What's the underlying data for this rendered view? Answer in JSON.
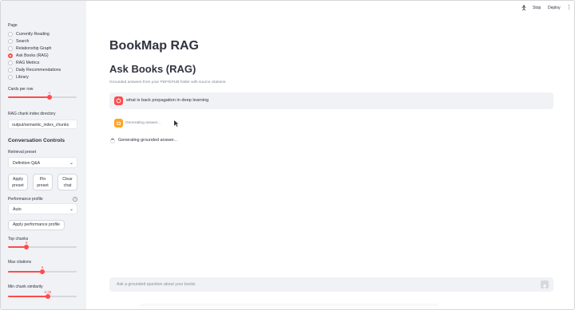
{
  "colors": {
    "accent": "#ff4b4b",
    "sidebar_bg": "#f0f2f6",
    "assistant_avatar": "#ffa421",
    "text": "#31333f",
    "muted": "#808495"
  },
  "topbar": {
    "stop_label": "Stop",
    "deploy_label": "Deploy",
    "running_icon": "running-man-icon",
    "menu_icon": "more-vertical-icon"
  },
  "sidebar": {
    "page_label": "Page",
    "pages": [
      {
        "label": "Currently Reading",
        "selected": false
      },
      {
        "label": "Search",
        "selected": false
      },
      {
        "label": "Relationship Graph",
        "selected": false
      },
      {
        "label": "Ask Books (RAG)",
        "selected": true
      },
      {
        "label": "RAG Metrics",
        "selected": false
      },
      {
        "label": "Daily Recommendations",
        "selected": false
      },
      {
        "label": "Library",
        "selected": false
      }
    ],
    "cards_per_row": {
      "label": "Cards per row",
      "value": "4",
      "fraction": 0.6
    },
    "rag_dir": {
      "label": "RAG chunk index directory",
      "value": "output/semantic_index_chunks"
    },
    "conversation_controls_title": "Conversation Controls",
    "retrieval_preset": {
      "label": "Retrieval preset",
      "value": "Definition Q&A"
    },
    "buttons": {
      "apply_preset": "Apply preset",
      "pin_preset": "Pin preset",
      "clear_chat": "Clear chat"
    },
    "performance_profile": {
      "label": "Performance profile",
      "value": "Auto"
    },
    "apply_performance_label": "Apply performance profile",
    "top_chunks": {
      "label": "Top chunks",
      "value": "8",
      "fraction": 0.27
    },
    "max_citations": {
      "label": "Max citations",
      "value": "6",
      "fraction": 0.5
    },
    "min_similarity": {
      "label": "Min chunk similarity",
      "value": "0.25",
      "fraction": 0.58
    }
  },
  "main": {
    "app_title": "BookMap RAG",
    "page_header": "Ask Books (RAG)",
    "caption": "Grounded answers from your PDF/EPUB folder with source citations.",
    "user_message": "what is back propagation in deep learning",
    "assistant_placeholder": "Generating answer...",
    "status": "Generating grounded answer...",
    "chat_placeholder": "Ask a grounded question about your books"
  }
}
